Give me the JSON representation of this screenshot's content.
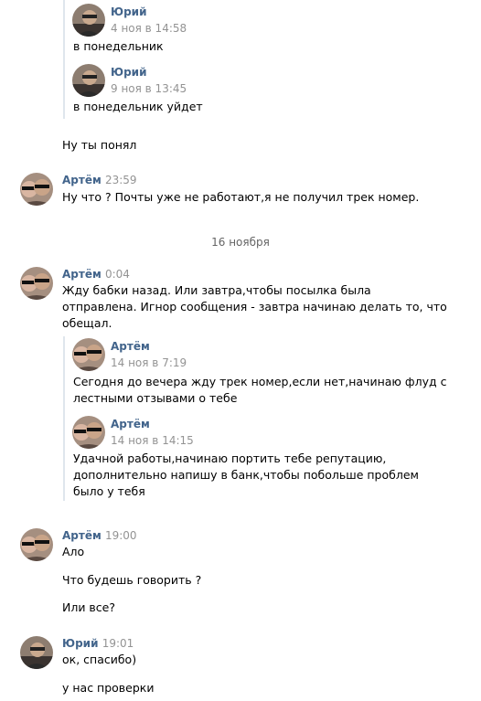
{
  "fwd_top": [
    {
      "author": "Юрий",
      "time": "4 ноя в 14:58",
      "text": "в понедельник"
    },
    {
      "author": "Юрий",
      "time": "9 ноя в 13:45",
      "text": "в понедельник уйдет"
    }
  ],
  "msg_continuation": "Ну ты понял",
  "msg_artem_1": {
    "author": "Артём",
    "time": "23:59",
    "text": "Ну что ? Почты уже не работают,я не получил трек номер."
  },
  "date_separator": "16 ноября",
  "msg_artem_2": {
    "author": "Артём",
    "time": "0:04",
    "text_lines": [
      "Жду бабки назад. Или завтра,чтобы посылка была",
      "отправлена. Игнор сообщения - завтра начинаю делать то, что",
      "обещал."
    ],
    "forwarded": [
      {
        "author": "Артём",
        "time": "14 ноя в 7:19",
        "text_lines": [
          "Сегодня до вечера жду трек номер,если нет,начинаю флуд с",
          "лестными отзывами о тебе"
        ]
      },
      {
        "author": "Артём",
        "time": "14 ноя в 14:15",
        "text_lines": [
          "Удачной работы,начинаю портить тебе репутацию,",
          "дополнительно напишу в банк,чтобы побольше проблем",
          "было у тебя"
        ]
      }
    ]
  },
  "msg_artem_3": {
    "author": "Артём",
    "time": "19:00",
    "texts": [
      "Ало",
      "Что будешь говорить ?",
      "Или все?"
    ]
  },
  "msg_yuri": {
    "author": "Юрий",
    "time": "19:01",
    "texts": [
      "ок, спасибо)",
      "у нас проверки"
    ]
  },
  "colors": {
    "author_name": "#42648b",
    "timestamp": "#939393",
    "forward_bar": "#dfe6ed",
    "date_separator": "#656565"
  },
  "avatars": {
    "yuri": "avatar-photo-yuri",
    "artem": "avatar-photo-artem"
  }
}
